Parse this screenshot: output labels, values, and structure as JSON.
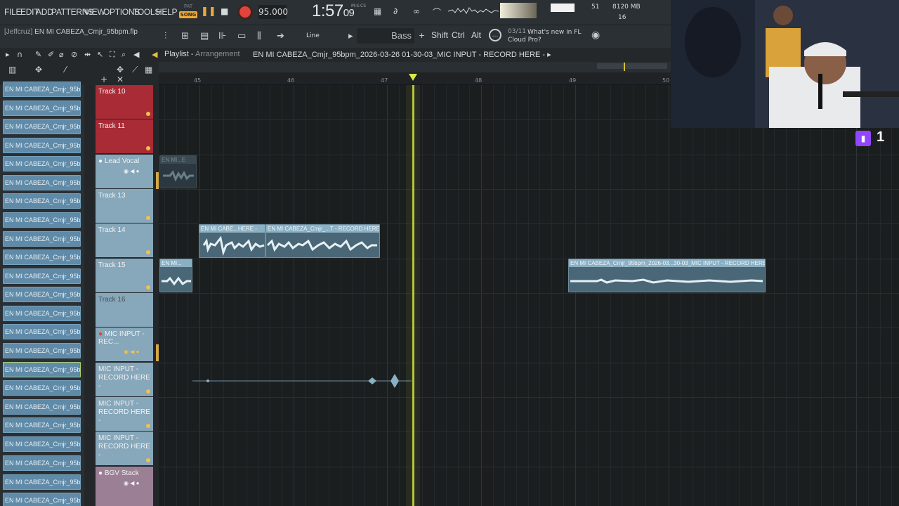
{
  "menu": [
    "FILE",
    "EDIT",
    "ADD",
    "PATTERNS",
    "VIEW",
    "OPTIONS",
    "TOOLS",
    "HELP"
  ],
  "transport": {
    "pat_label": "PAT",
    "song_label": "SONG",
    "tempo": "95.000",
    "time": "1:57",
    "time_sub": "09",
    "time_unit": "M:S:CS"
  },
  "monitor": {
    "cpu": "51",
    "memory": "8120 MB",
    "polyphony": "16"
  },
  "project": {
    "user": "[Jeffcruz]",
    "file": "EN MI CABEZA_Cmjr_95bpm.flp"
  },
  "toolbar": {
    "snap": "Line",
    "pattern": "Bass",
    "plus": "+",
    "shift": "Shift",
    "ctrl": "Ctrl",
    "alt": "Alt"
  },
  "news": {
    "count": "03/11",
    "text": "What's new in FL",
    "text2": "Cloud Pro?"
  },
  "playlist": {
    "title": "Playlist",
    "subtitle": "Arrangement",
    "breadcrumb": "EN MI CABEZA_Cmjr_95bpm_2026-03-26 01-30-03_MIC INPUT - RECORD HERE - ▸"
  },
  "ruler": [
    "45",
    "46",
    "47",
    "48",
    "49",
    "50"
  ],
  "browser_item_label": "EN MI CABEZA_Cmjr_95bp...",
  "tracks": [
    {
      "name": "Track 10"
    },
    {
      "name": "Track 11"
    },
    {
      "name": "Lead Vocal"
    },
    {
      "name": "Track 13"
    },
    {
      "name": "Track 14"
    },
    {
      "name": "Track 15"
    },
    {
      "name": "Track 16"
    },
    {
      "name": "MIC INPUT - REC..."
    },
    {
      "name": "MIC INPUT - RECORD HERE -"
    },
    {
      "name": "MIC INPUT - RECORD HERE -"
    },
    {
      "name": "MIC INPUT - RECORD HERE -"
    },
    {
      "name": "BGV Stack"
    }
  ],
  "clips": {
    "lead_vocal": "EN MI...E",
    "t14_a": "EN MI CABE...HERE -",
    "t14_b": "EN MI CABEZA_Cmjr_...T - RECORD HERE -",
    "t15_a": "EN MI...",
    "t15_b": "EN MI CABEZA_Cmjr_95bpm_2026-03...30-03_MIC INPUT - RECORD HERE -"
  },
  "stream": {
    "viewers": "1"
  }
}
